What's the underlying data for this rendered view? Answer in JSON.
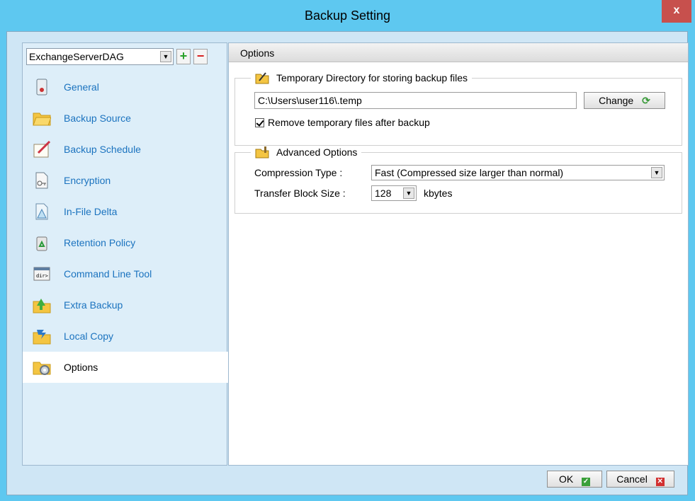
{
  "window": {
    "title": "Backup Setting",
    "close_label": "x"
  },
  "sidebar": {
    "profile": "ExchangeServerDAG",
    "add_label": "+",
    "remove_label": "−",
    "items": [
      {
        "label": "General",
        "icon": "general-icon"
      },
      {
        "label": "Backup Source",
        "icon": "folder-icon"
      },
      {
        "label": "Backup Schedule",
        "icon": "schedule-icon"
      },
      {
        "label": "Encryption",
        "icon": "encryption-icon"
      },
      {
        "label": "In-File Delta",
        "icon": "delta-icon"
      },
      {
        "label": "Retention Policy",
        "icon": "recycle-bin-icon"
      },
      {
        "label": "Command Line Tool",
        "icon": "terminal-icon"
      },
      {
        "label": "Extra Backup",
        "icon": "extra-backup-icon"
      },
      {
        "label": "Local Copy",
        "icon": "local-copy-icon"
      },
      {
        "label": "Options",
        "icon": "options-icon",
        "active": true
      }
    ]
  },
  "main": {
    "header": "Options",
    "temp_dir": {
      "legend": "Temporary Directory for storing backup files",
      "path": "C:\\Users\\user116\\.temp",
      "change_label": "Change",
      "remove_label": "Remove temporary files after backup",
      "remove_checked": true
    },
    "advanced": {
      "legend": "Advanced Options",
      "compression_label": "Compression Type :",
      "compression_value": "Fast (Compressed size larger than normal)",
      "block_label": "Transfer Block Size :",
      "block_value": "128",
      "block_unit": "kbytes"
    }
  },
  "footer": {
    "ok_label": "OK",
    "cancel_label": "Cancel"
  },
  "colors": {
    "title_bar": "#5ec8f0",
    "link": "#1b73bf",
    "close": "#c7504d"
  }
}
